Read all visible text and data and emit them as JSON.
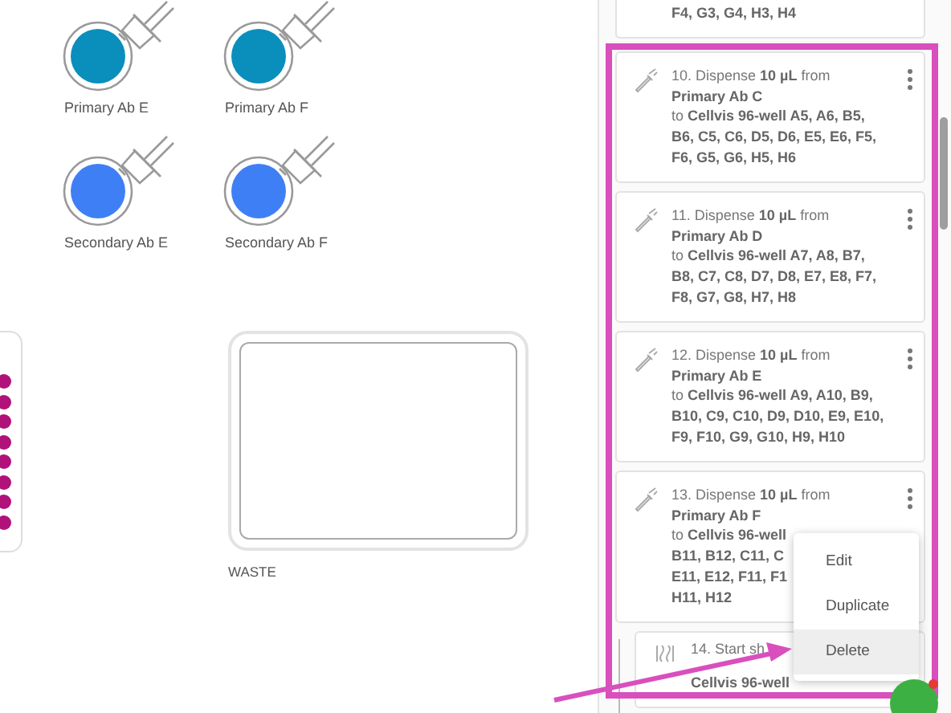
{
  "deck": {
    "reagents": [
      {
        "label": "Primary Ab E",
        "color": "#0a8fbd"
      },
      {
        "label": "Primary Ab F",
        "color": "#0a8fbd"
      },
      {
        "label": "Secondary Ab E",
        "color": "#3f7ff5"
      },
      {
        "label": "Secondary Ab F",
        "color": "#3f7ff5"
      }
    ],
    "plate_dots": {
      "color": "#b0127a"
    },
    "waste": {
      "label": "WASTE"
    }
  },
  "steps": [
    {
      "kind": "partial",
      "lines": [
        "**F4, G3, G4, H3, H4**"
      ]
    },
    {
      "kind": "dispense",
      "lines": [
        "10.  Dispense **10 µL** from",
        "**Primary Ab C**",
        "to **Cellvis 96-well A5, A6, B5,**",
        "**B6, C5, C6, D5, D6, E5, E6, F5,**",
        "**F6, G5, G6, H5, H6**"
      ]
    },
    {
      "kind": "dispense",
      "lines": [
        "11.  Dispense **10 µL** from",
        "**Primary Ab D**",
        "to **Cellvis 96-well A7, A8, B7,**",
        "**B8, C7, C8, D7, D8, E7, E8, F7,**",
        "**F8, G7, G8, H7, H8**"
      ]
    },
    {
      "kind": "dispense",
      "lines": [
        "12.  Dispense **10 µL** from",
        "**Primary Ab E**",
        "to **Cellvis 96-well A9, A10, B9,**",
        "**B10, C9, C10, D9, D10, E9, E10,**",
        "**F9, F10, G9, G10, H9, H10**"
      ]
    },
    {
      "kind": "dispense",
      "lines": [
        "13.  Dispense **10 µL** from",
        "**Primary Ab F**",
        "to **Cellvis 96-well**",
        "**B11, B12, C11, C**",
        "**E11, E12, F11, F1**",
        "**H11, H12**"
      ]
    },
    {
      "kind": "shake",
      "lines": [
        "14.  Start sh",
        "**Cellvis 96-well**"
      ]
    }
  ],
  "context_menu": {
    "items": [
      {
        "label": "Edit",
        "highlighted": false
      },
      {
        "label": "Duplicate",
        "highlighted": false
      },
      {
        "label": "Delete",
        "highlighted": true
      }
    ]
  }
}
